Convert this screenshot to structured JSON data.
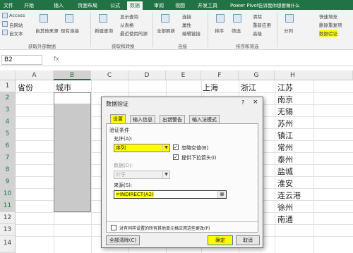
{
  "ribbon": {
    "tabs": [
      "文件",
      "开始",
      "插入",
      "页面布局",
      "公式",
      "数据",
      "审阅",
      "视图",
      "开发工具",
      "Power Pivot"
    ],
    "tell_me": "告诉我你想要做什么",
    "ext_data": {
      "access": "Access",
      "web": "自网站",
      "text": "自文本",
      "other": "自其他来源",
      "existing": "现有连接",
      "label": "获取外部数据"
    },
    "transform": {
      "new_query": "新建查询",
      "show_query": "显示查询",
      "from_table": "从表格",
      "recent": "最近使用的源",
      "label": "获取和转换"
    },
    "connections": {
      "refresh_all": "全部刷新",
      "conn": "连接",
      "props": "属性",
      "edit_links": "编辑链接",
      "label": "连接"
    },
    "sort_filter": {
      "sort": "排序",
      "filter": "筛选",
      "clear": "清除",
      "reapply": "重新应用",
      "advanced": "高级",
      "label": "排序和筛选"
    },
    "tools": {
      "split": "分列",
      "flash": "快速填充",
      "remove_dup": "删除重复项",
      "validation": "数据验证"
    }
  },
  "formula_bar": {
    "name_box": "B2",
    "fx": "fx"
  },
  "sheet": {
    "columns": [
      "A",
      "B",
      "C",
      "D",
      "E",
      "F",
      "G",
      "H"
    ],
    "rows": [
      "1",
      "2",
      "3",
      "4",
      "5",
      "6",
      "7",
      "8",
      "9",
      "10",
      "11",
      "12",
      "13",
      "14"
    ],
    "a1": "省份",
    "b1": "城市",
    "f1": "上海",
    "g1": "浙江",
    "h_col": [
      "江苏",
      "南京",
      "无锡",
      "苏州",
      "镇江",
      "常州",
      "泰州",
      "盐城",
      "淮安",
      "连云港",
      "徐州",
      "南通"
    ]
  },
  "dialog": {
    "title": "数据验证",
    "help": "?",
    "close": "×",
    "tabs": [
      "设置",
      "输入信息",
      "出错警告",
      "输入法模式"
    ],
    "criteria_label": "验证条件",
    "allow_label": "允许(A):",
    "allow_value": "序列",
    "ignore_blank": "忽略空值(B)",
    "dropdown": "提供下拉箭头(I)",
    "data_label": "数据(D):",
    "data_value": "介于",
    "source_label": "来源(S):",
    "source_value": "=INDIRECT(A2)",
    "apply_all": "对有同样设置的所有其他单元格应用这些更改(P)",
    "clear_all": "全部清除(C)",
    "ok": "确定",
    "cancel": "取消"
  },
  "colors": {
    "excel_green": "#217346",
    "highlight": "#ffff00",
    "selection": "#c9c9c9"
  }
}
